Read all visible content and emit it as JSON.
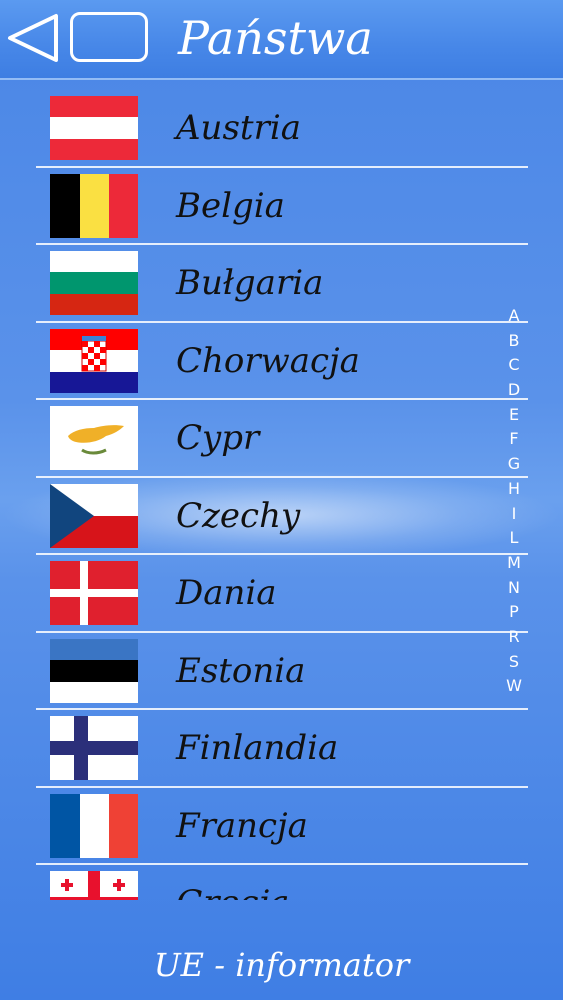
{
  "header": {
    "title": "Państwa"
  },
  "countries": [
    {
      "name": "Austria",
      "flag": "austria-flag"
    },
    {
      "name": "Belgia",
      "flag": "belgium-flag"
    },
    {
      "name": "Bułgaria",
      "flag": "bulgaria-flag"
    },
    {
      "name": "Chorwacja",
      "flag": "croatia-flag"
    },
    {
      "name": "Cypr",
      "flag": "cyprus-flag"
    },
    {
      "name": "Czechy",
      "flag": "czech-flag"
    },
    {
      "name": "Dania",
      "flag": "denmark-flag"
    },
    {
      "name": "Estonia",
      "flag": "estonia-flag"
    },
    {
      "name": "Finlandia",
      "flag": "finland-flag"
    },
    {
      "name": "Francja",
      "flag": "france-flag"
    },
    {
      "name": "Grecja",
      "flag": "georgia-flag"
    }
  ],
  "alphabet_index": [
    "A",
    "B",
    "C",
    "D",
    "E",
    "F",
    "G",
    "H",
    "I",
    "L",
    "M",
    "N",
    "P",
    "R",
    "S",
    "W"
  ],
  "footer": {
    "label": "UE - informator"
  },
  "colors": {
    "background": "#4a86e6",
    "text": "#111111",
    "header_text": "#ffffff"
  }
}
